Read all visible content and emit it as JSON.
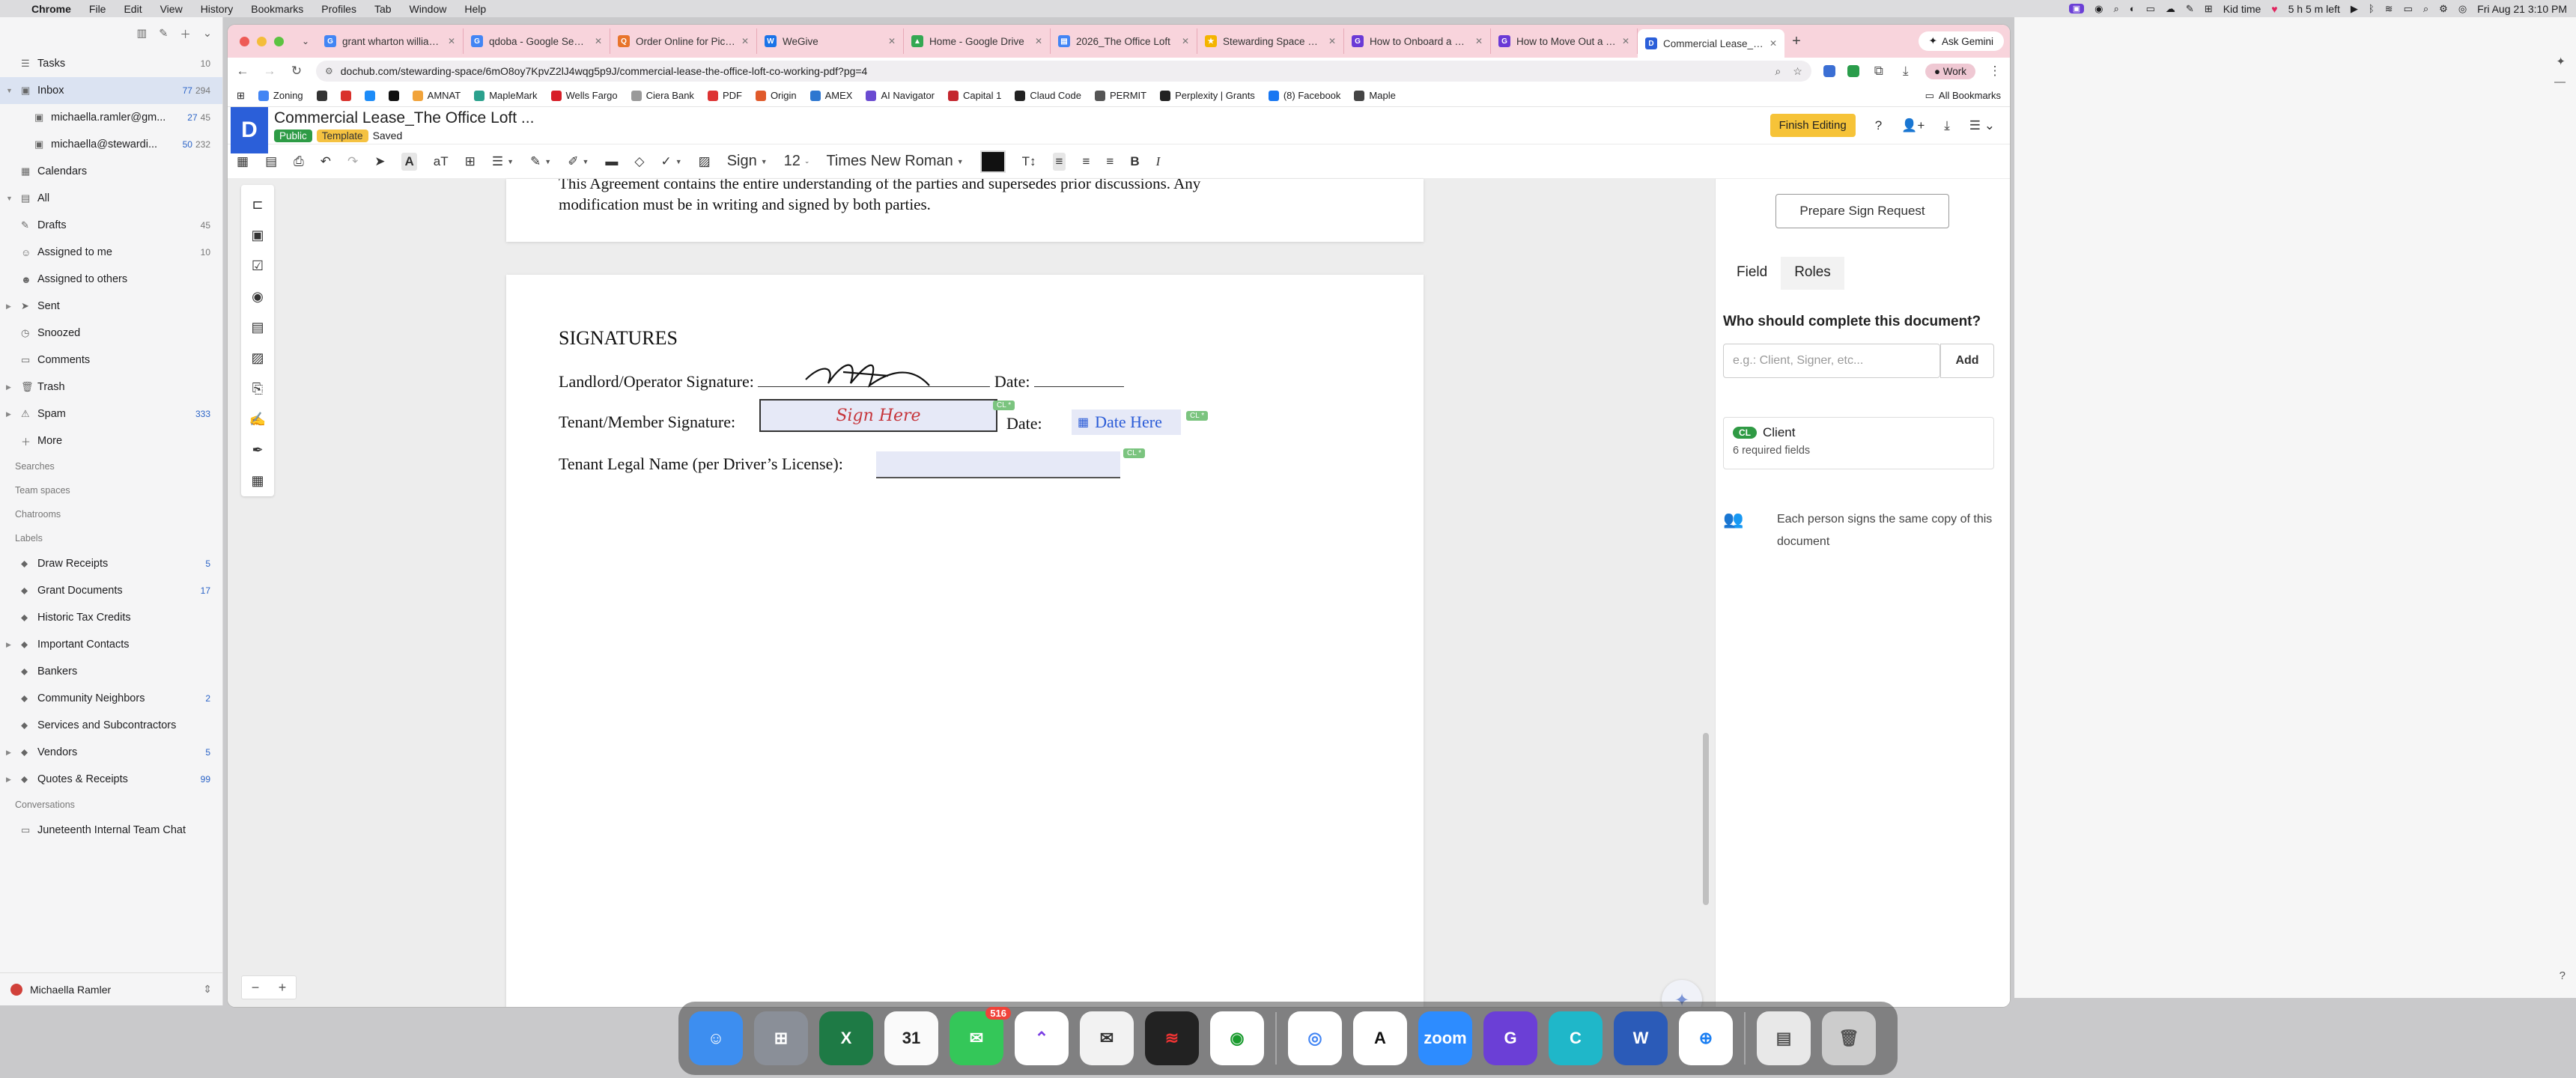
{
  "menubar": {
    "items": [
      "Chrome",
      "File",
      "Edit",
      "View",
      "History",
      "Bookmarks",
      "Profiles",
      "Tab",
      "Window",
      "Help"
    ],
    "kid_time": "Kid time",
    "time_left": "5 h 5 m left",
    "datetime": "Fri Aug 21  3:10 PM"
  },
  "mail": {
    "items": [
      {
        "label": "Tasks",
        "count": "10"
      },
      {
        "label": "Inbox",
        "count": "77",
        "count2": "294"
      },
      {
        "label": "michaella.ramler@gm...",
        "count": "27",
        "count2": "45"
      },
      {
        "label": "michaella@stewardi...",
        "count": "50",
        "count2": "232"
      },
      {
        "label": "Calendars",
        "count": ""
      },
      {
        "label": "All",
        "count": ""
      },
      {
        "label": "Drafts",
        "count": "45"
      },
      {
        "label": "Assigned to me",
        "count": "10"
      },
      {
        "label": "Assigned to others",
        "count": ""
      },
      {
        "label": "Sent",
        "count": ""
      },
      {
        "label": "Snoozed",
        "count": ""
      },
      {
        "label": "Comments",
        "count": ""
      },
      {
        "label": "Trash",
        "count": ""
      },
      {
        "label": "Spam",
        "count": "333"
      },
      {
        "label": "More",
        "count": ""
      }
    ],
    "sections": {
      "searches": "Searches",
      "team_spaces": "Team spaces",
      "chatrooms": "Chatrooms",
      "labels": "Labels",
      "conversations": "Conversations"
    },
    "labels": [
      {
        "label": "Draw Receipts",
        "count": "5"
      },
      {
        "label": "Grant Documents",
        "count": "17"
      },
      {
        "label": "Historic Tax Credits",
        "count": ""
      },
      {
        "label": "Important Contacts",
        "count": ""
      },
      {
        "label": "Bankers",
        "count": ""
      },
      {
        "label": "Community Neighbors",
        "count": "2"
      },
      {
        "label": "Services and Subcontractors",
        "count": ""
      },
      {
        "label": "Vendors",
        "count": "5"
      },
      {
        "label": "Quotes & Receipts",
        "count": "99"
      }
    ],
    "conversation": "Juneteenth Internal Team Chat",
    "user": "Michaella Ramler"
  },
  "tabs": [
    {
      "title": "grant wharton williams",
      "color": "#4285f4"
    },
    {
      "title": "qdoba - Google Search",
      "color": "#4285f4"
    },
    {
      "title": "Order Online for Pickup",
      "color": "#e8742b"
    },
    {
      "title": "WeGive",
      "color": "#1a73e8"
    },
    {
      "title": "Home - Google Drive",
      "color": "#34a853"
    },
    {
      "title": "2026_The Office Loft",
      "color": "#4285f4"
    },
    {
      "title": "Stewarding Space — S",
      "color": "#f4b400"
    },
    {
      "title": "How to Onboard a New",
      "color": "#6a3ad6"
    },
    {
      "title": "How to Move Out a Te",
      "color": "#6a3ad6"
    },
    {
      "title": "Commercial Lease_The",
      "color": "#2b5fd9"
    }
  ],
  "ask_gemini": "Ask Gemini",
  "url": "dochub.com/stewarding-space/6mO8oy7KpvZ2lJ4wqg5p9J/commercial-lease-the-office-loft-co-working-pdf?pg=4",
  "profile": "Work",
  "bookmarks": [
    "Zoning",
    "AMNAT",
    "MapleMark",
    "Wells Fargo",
    "Ciera Bank",
    "PDF",
    "Origin",
    "AMEX",
    "AI Navigator",
    "Capital 1",
    "Claud Code",
    "PERMIT",
    "Perplexity | Grants",
    "(8) Facebook",
    "Maple"
  ],
  "all_bookmarks": "All Bookmarks",
  "doc": {
    "title": "Commercial Lease_The Office Loft ...",
    "badge_public": "Public",
    "badge_template": "Template",
    "saved": "Saved",
    "finish_editing": "Finish Editing",
    "toolbar_sign": "Sign",
    "toolbar_size": "12",
    "toolbar_font": "Times New Roman",
    "prev_text_1": "This Agreement contains the entire understanding of the parties and supersedes prior discussions. Any",
    "prev_text_2": "modification must be in writing and signed by both parties.",
    "heading": "SIGNATURES",
    "landlord_label": "Landlord/Operator Signature:",
    "date_label": "Date:",
    "tenant_label": "Tenant/Member Signature:",
    "sign_here": "Sign Here",
    "date_here": "Date Here",
    "tenant_name_label": "Tenant Legal Name (per Driver’s License):",
    "cl_tag": "CL *"
  },
  "panel": {
    "prepare": "Prepare Sign Request",
    "tab_field": "Field",
    "tab_roles": "Roles",
    "question": "Who should complete this document?",
    "placeholder": "e.g.: Client, Signer, etc...",
    "add": "Add",
    "role_chip": "CL",
    "role_name": "Client",
    "role_sub": "6 required fields",
    "note": "Each person signs the same copy of this document"
  },
  "dock": {
    "messages_badge": "516",
    "calendar_day": "31"
  }
}
